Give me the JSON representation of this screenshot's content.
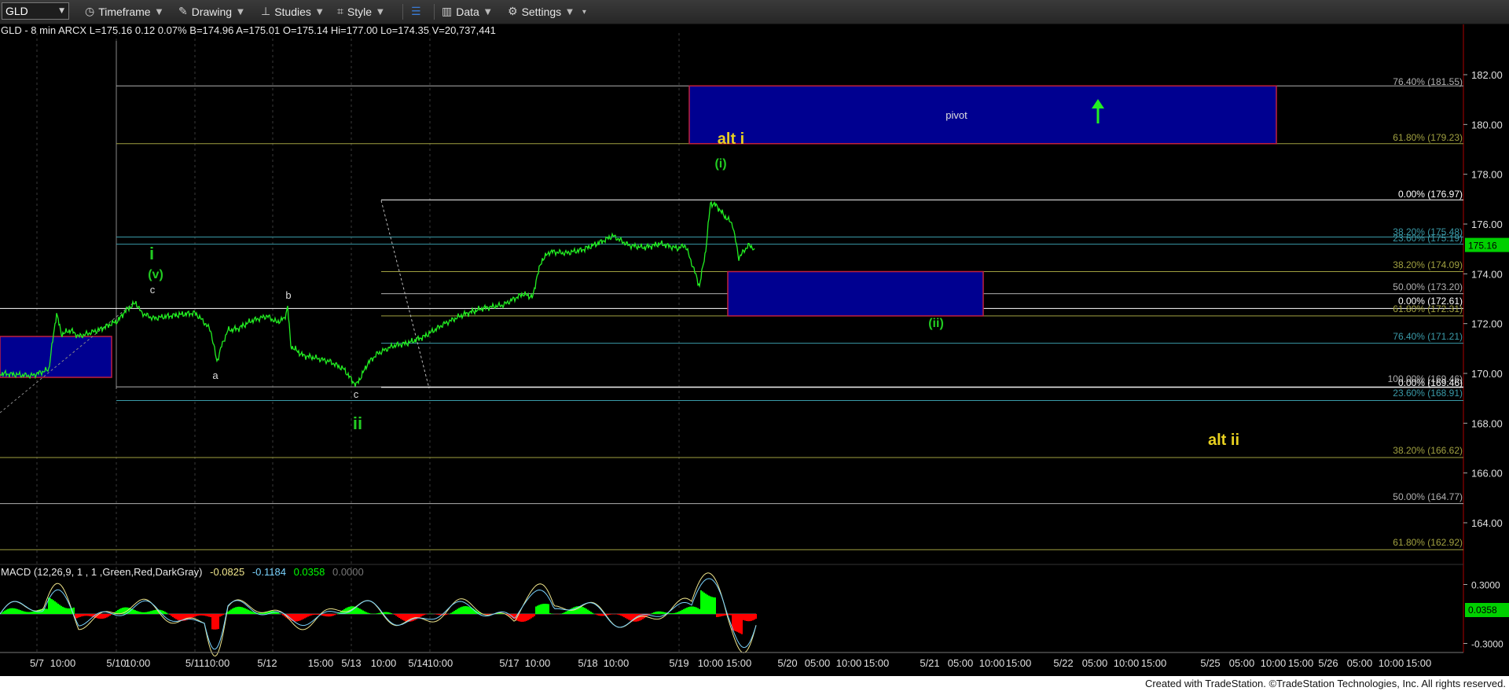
{
  "toolbar": {
    "symbol": "GLD",
    "items": [
      {
        "label": "Timeframe",
        "icon": "clock-icon"
      },
      {
        "label": "Drawing",
        "icon": "pencil-icon"
      },
      {
        "label": "Studies",
        "icon": "studies-icon"
      },
      {
        "label": "Style",
        "icon": "style-icon"
      },
      {
        "label": "Data",
        "icon": "data-icon"
      },
      {
        "label": "Settings",
        "icon": "gear-icon"
      }
    ]
  },
  "quote_line": "GLD - 8 min  ARCX  L=175.16  0.12  0.07%  B=174.96  A=175.01  O=175.14  Hi=177.00  Lo=174.35  V=20,737,441",
  "price_axis": [
    "182.00",
    "180.00",
    "178.00",
    "176.00",
    "174.00",
    "172.00",
    "170.00",
    "168.00",
    "166.00",
    "164.00"
  ],
  "last_price": "175.16",
  "macd": {
    "label": "MACD (12,26,9, 1 , 1 ,Green,Red,DarkGray)",
    "values": [
      "-0.0825",
      "-0.1184",
      "0.0358",
      "0.0000"
    ],
    "value_colors": [
      "#f0e68c",
      "#7ad3ff",
      "#00ff00",
      "#777777"
    ],
    "axis": [
      "0.3000",
      "-0.3000"
    ],
    "current": "0.0358"
  },
  "time_axis": [
    "5/7",
    "10:00",
    "5/10",
    "10:00",
    "5/11",
    "10:00",
    "5/12",
    "15:00",
    "5/13",
    "10:00",
    "5/14",
    "10:00",
    "5/17",
    "10:00",
    "5/18",
    "10:00",
    "5/19",
    "10:00",
    "15:00",
    "5/20",
    "05:00",
    "10:00",
    "15:00",
    "5/21",
    "05:00",
    "10:00",
    "15:00",
    "5/22",
    "05:00",
    "10:00",
    "15:00",
    "5/25",
    "05:00",
    "10:00",
    "15:00",
    "5/26",
    "05:00",
    "10:00",
    "15:00"
  ],
  "fib_labels": [
    {
      "text": "76.40% (181.55)",
      "color": "#b0b0b0"
    },
    {
      "text": "61.80% (179.23)",
      "color": "#a0a040"
    },
    {
      "text": "0.00% (176.97)",
      "color": "#ffffff"
    },
    {
      "text": "38.20% (175.48)",
      "color": "#3a9aa8"
    },
    {
      "text": "23.60% (175.19)",
      "color": "#3a9aa8"
    },
    {
      "text": "38.20% (174.09)",
      "color": "#a0a040"
    },
    {
      "text": "50.00% (173.20)",
      "color": "#b0b0b0"
    },
    {
      "text": "0.00% (172.61)",
      "color": "#ffffff"
    },
    {
      "text": "61.80% (172.31)",
      "color": "#a0a040"
    },
    {
      "text": "76.40% (171.21)",
      "color": "#3a9aa8"
    },
    {
      "text": "100.00% (169.46)",
      "color": "#b0b0b0"
    },
    {
      "text": "0.00% (169.46)",
      "color": "#ffffff"
    },
    {
      "text": "23.60% (168.91)",
      "color": "#3a9aa8"
    },
    {
      "text": "38.20% (166.62)",
      "color": "#a0a040"
    },
    {
      "text": "50.00% (164.77)",
      "color": "#b0b0b0"
    },
    {
      "text": "61.80% (162.92)",
      "color": "#a0a040"
    }
  ],
  "wave_labels": [
    {
      "text": "i",
      "color": "#22cc22"
    },
    {
      "text": "(v)",
      "color": "#22cc22"
    },
    {
      "text": "c",
      "color": "#dddddd"
    },
    {
      "text": "a",
      "color": "#dddddd"
    },
    {
      "text": "b",
      "color": "#dddddd"
    },
    {
      "text": "c",
      "color": "#dddddd"
    },
    {
      "text": "ii",
      "color": "#22cc22"
    },
    {
      "text": "alt i",
      "color": "#e8d020"
    },
    {
      "text": "(i)",
      "color": "#22cc22"
    },
    {
      "text": "(ii)",
      "color": "#22cc22"
    },
    {
      "text": "alt ii",
      "color": "#e8d020"
    }
  ],
  "pivot_label": "pivot",
  "colors": {
    "price": "#22ee22",
    "box_fill": "#000090",
    "box_border": "#c02040",
    "macd_up": "#00ff00",
    "macd_down": "#ff0000"
  },
  "copyright": "Created with TradeStation. ©TradeStation Technologies, Inc. All rights reserved."
}
